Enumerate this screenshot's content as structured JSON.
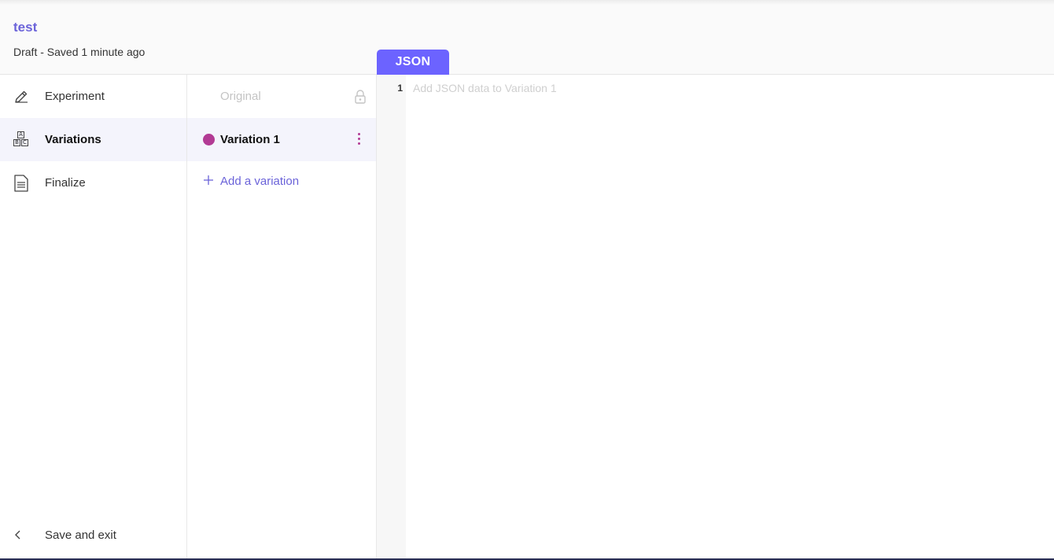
{
  "header": {
    "title": "test",
    "status": "Draft - Saved 1 minute ago"
  },
  "editor_tabs": {
    "active": "JSON"
  },
  "sidebar": {
    "items": [
      {
        "label": "Experiment",
        "icon": "pencil-icon",
        "active": false
      },
      {
        "label": "Variations",
        "icon": "abc-blocks-icon",
        "active": true
      },
      {
        "label": "Finalize",
        "icon": "document-icon",
        "active": false
      }
    ],
    "save_exit": {
      "label": "Save and exit",
      "icon": "chevron-left-icon"
    }
  },
  "variations": {
    "original": {
      "label": "Original",
      "icon": "lock-icon"
    },
    "list": [
      {
        "label": "Variation 1",
        "color": "#b23a94",
        "selected": true
      }
    ],
    "add_label": "Add a variation",
    "add_icon": "plus-icon"
  },
  "editor": {
    "line_numbers": [
      "1"
    ],
    "placeholder": "Add JSON data to Variation 1",
    "value": ""
  },
  "colors": {
    "accent": "#6c63ff",
    "title": "#6b63d9",
    "variation_dot": "#b23a94",
    "selected_bg": "#f4f4fc"
  }
}
